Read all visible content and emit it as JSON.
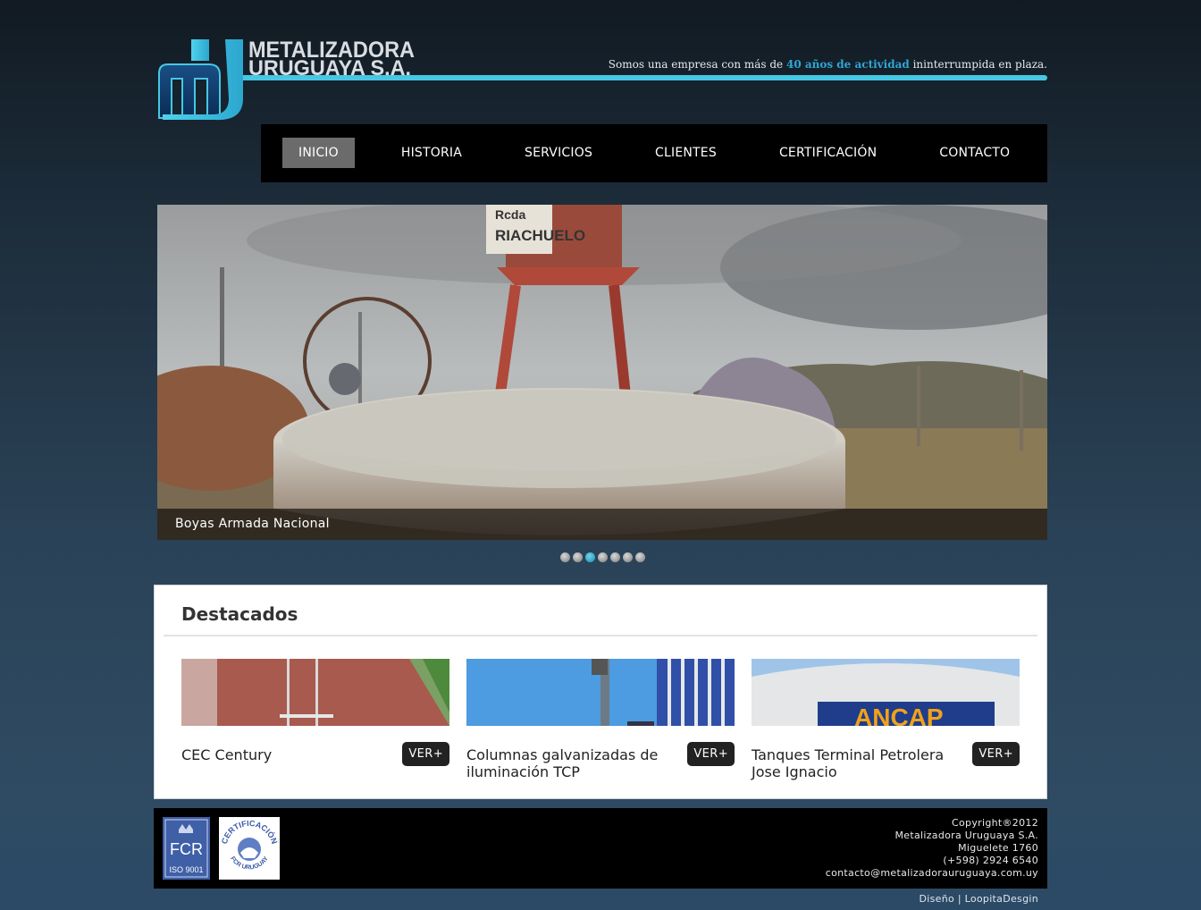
{
  "brand": {
    "name_line1": "METALIZADORA",
    "name_line2": "URUGUAYA S.A."
  },
  "tagline": {
    "before": "Somos una empresa con más de ",
    "highlight": "40 años de actividad",
    "after": " ininterrumpida en plaza."
  },
  "nav": {
    "items": [
      "INICIO",
      "HISTORIA",
      "SERVICIOS",
      "CLIENTES",
      "CERTIFICACIÓN",
      "CONTACTO"
    ],
    "active": "INICIO"
  },
  "slider": {
    "caption": "Boyas Armada Nacional",
    "image_text": [
      "Rcda",
      "RIACHUELO"
    ],
    "slide_count": 7,
    "active_slide": 3
  },
  "featured": {
    "heading": "Destacados",
    "items": [
      {
        "title": "CEC Century",
        "button": "VER+"
      },
      {
        "title": "Columnas galvanizadas de iluminación TCP",
        "button": "VER+"
      },
      {
        "title": "Tanques Terminal Petrolera Jose Ignacio",
        "button": "VER+"
      }
    ],
    "tank_sign_text": "ANCAP"
  },
  "footer": {
    "badge_left": {
      "line1": "FCR",
      "line2": "ISO 9001"
    },
    "badge_right": {
      "arc_top": "CERTIFICACIÓN",
      "arc_bottom": "FCR URUGUAY"
    },
    "copyright": "Copyright®2012",
    "company": "Metalizadora Uruguaya S.A.",
    "address": "Miguelete 1760",
    "phone": "(+598) 2924 6540",
    "email": "contacto@metalizadorauruguaya.com.uy"
  },
  "credit": {
    "label": "Diseño",
    "separator": "|",
    "designer": "LoopitaDesgin"
  },
  "colors": {
    "accent": "#46c7e3",
    "highlight_text": "#2fa6d6",
    "nav_active": "#6b6b6b"
  }
}
